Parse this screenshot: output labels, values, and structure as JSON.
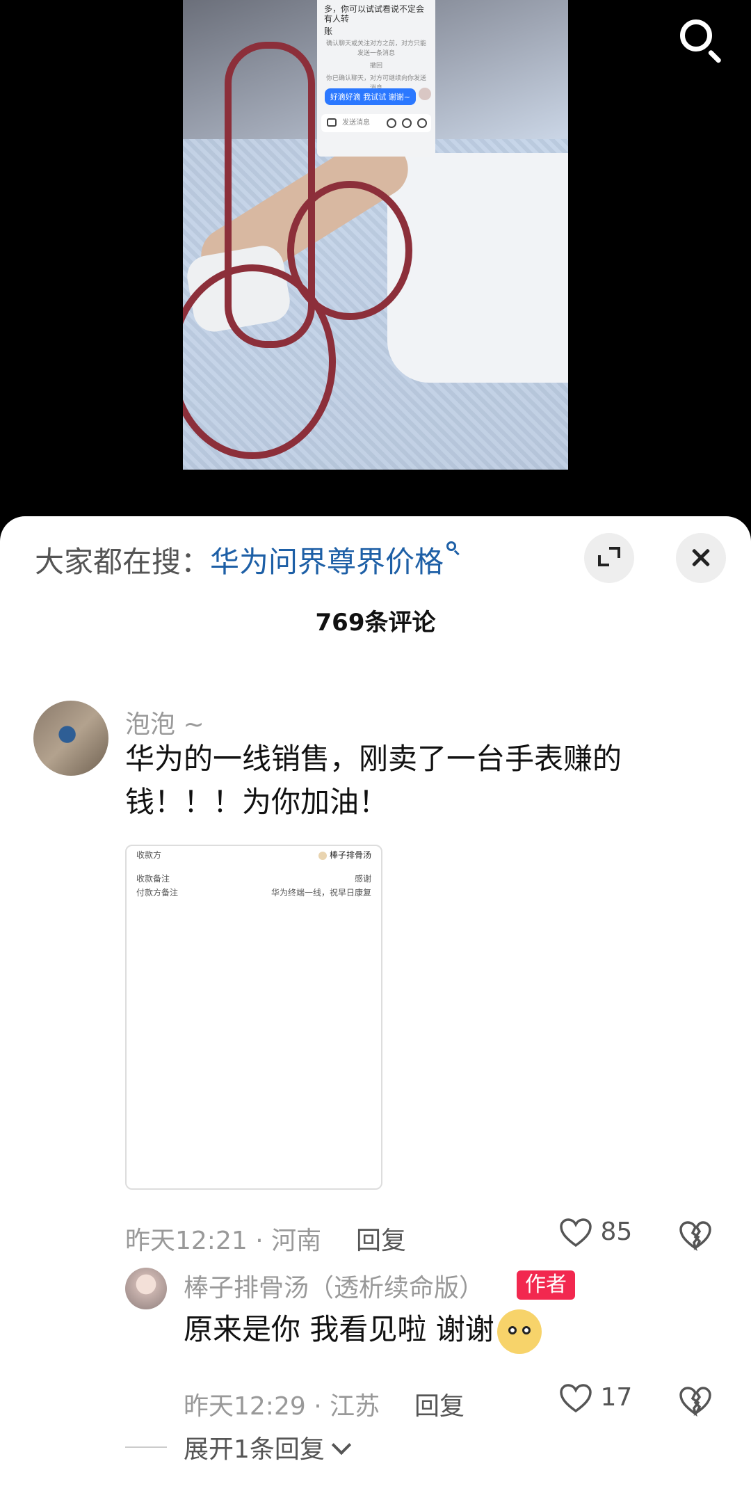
{
  "video": {
    "chat_lines": [
      "多，你可以试试看说不定会有人转",
      "账",
      "确认聊天或关注对方之前，对方只能发送一条消息",
      "撤回",
      "你已确认聊天，对方可继续向你发送消息"
    ],
    "chat_bubble": "好滴好滴 我试试 谢谢~",
    "chat_input_placeholder": "发送消息"
  },
  "header": {
    "suggest_prefix": "大家都在搜：",
    "suggest_keyword": "华为问界尊界价格"
  },
  "comments": {
    "count_label": "769条评论",
    "main": {
      "username": "泡泡 ~",
      "text": "华为的一线销售，刚卖了一台手表赚的钱！！！为你加油！",
      "receipt": {
        "payee_label": "收款方",
        "payee_name": "棒子排骨汤",
        "remark_label": "收款备注",
        "remark_value": "感谢",
        "payer_remark_label": "付款方备注",
        "payer_remark_value": "华为终端一线，祝早日康复"
      },
      "meta": "昨天12:21 · 河南",
      "reply_label": "回复",
      "likes": "85"
    },
    "reply": {
      "username": "棒子排骨汤（透析续命版）",
      "author_tag": "作者",
      "text": "原来是你 我看见啦 谢谢",
      "meta": "昨天12:29 · 江苏",
      "reply_label": "回复",
      "likes": "17"
    },
    "expand_label": "展开1条回复"
  },
  "colors": {
    "keyword": "#1d5fa6",
    "author_tag_bg": "#f2284f",
    "bubble": "#2b78ff"
  }
}
